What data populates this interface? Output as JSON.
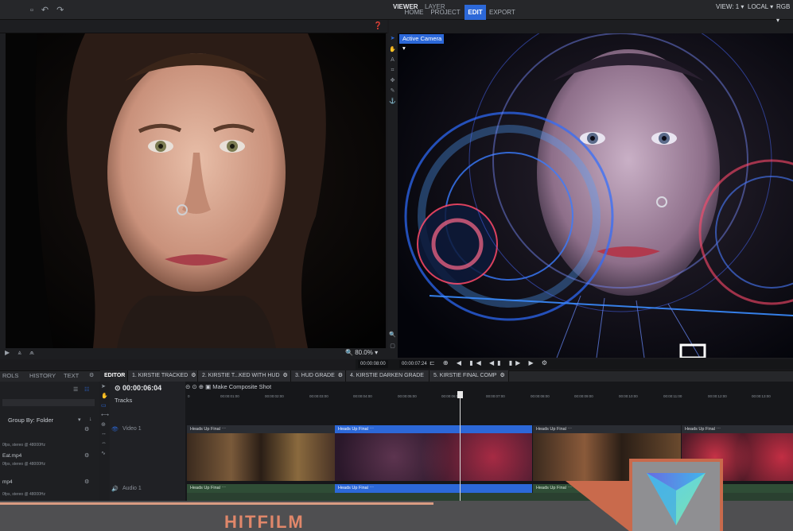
{
  "top_nav": {
    "tabs": [
      "HOME",
      "PROJECT",
      "EDIT",
      "EXPORT"
    ],
    "active": "EDIT"
  },
  "viewer": {
    "tabs": [
      "VIEWER",
      "LAYER"
    ],
    "active_tab": "VIEWER",
    "view_label": "VIEW: 1",
    "space_label": "LOCAL",
    "channel_label": "RGB",
    "camera": "Active Camera",
    "zoom": "80.0%",
    "timecode_left": "00:00:08:00",
    "timecode_right": "00:00:07:24"
  },
  "left_panel": {
    "tabs": [
      "ROLS",
      "HISTORY",
      "TEXT"
    ],
    "group_by": "Group By: Folder",
    "media": [
      {
        "name": "",
        "info": "0fps, stereo @ 48000Hz"
      },
      {
        "name": "Eat.mp4",
        "info": "0fps, stereo @ 48000Hz"
      },
      {
        "name": "mp4",
        "info": "0fps, stereo @ 48000Hz"
      }
    ]
  },
  "editor": {
    "tabs": [
      {
        "label": "EDITOR"
      },
      {
        "label": "1. KIRSTIE TRACKED"
      },
      {
        "label": "2. KIRSTIE T...KED WITH HUD"
      },
      {
        "label": "3. HUD GRADE"
      },
      {
        "label": "4. KIRSTIE DARKEN GRADE"
      },
      {
        "label": "5. KIRSTIE FINAL COMP"
      }
    ],
    "timecode": "00:00:06:04",
    "tracks_label": "Tracks",
    "make_composite": "Make Composite Shot",
    "video_track": "Video 1",
    "audio_track": "Audio 1",
    "ruler": [
      "0",
      "00:00:01:00",
      "00:00:02:00",
      "00:00:03:00",
      "00:00:04:00",
      "00:00:05:00",
      "00:00:06:00",
      "00:00:07:00",
      "00:00:08:00",
      "00:00:09:00",
      "00:00:10:00",
      "00:00:11:00",
      "00:00:12:00",
      "00:00:13:00"
    ],
    "video_clips": [
      "Heads Up Final",
      "Heads Up Final",
      "Heads Up Final",
      "Heads Up Final"
    ],
    "audio_clips": [
      "Heads Up Final",
      "Heads Up Final",
      "Heads Up Final"
    ]
  },
  "footer": {
    "brand": "HITFILM"
  },
  "colors": {
    "accent": "#2c68d8",
    "brand": "#e0876a",
    "logo_frame": "#c96a4c",
    "banner": "#4f4f51",
    "audio_clip": "#2f4d36"
  }
}
